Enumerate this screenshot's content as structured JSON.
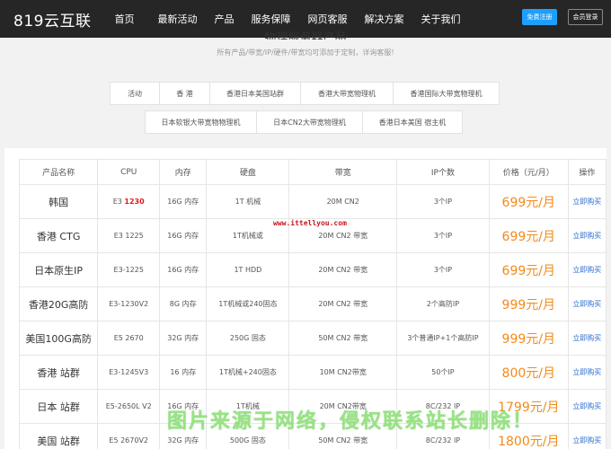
{
  "header": {
    "logo": "819云互联",
    "nav": [
      "首页",
      "最新活动",
      "产品",
      "服务保障",
      "网页客服",
      "解决方案",
      "关于我们"
    ],
    "register_label": "免费注册",
    "login_label": "会员登录"
  },
  "section": {
    "title": "物理服务器产品",
    "subtitle": "所有产品/带宽/IP/硬件/带宽均可添加于定制，详询客服!"
  },
  "filters": {
    "row1": [
      "活动",
      "香 港",
      "香港日本美国站群",
      "香港大带宽物理机",
      "香港国际大带宽物理机"
    ],
    "row2": [
      "日本软银大带宽物物理机",
      "日本CN2大带宽物理机",
      "香港日本美国 宿主机"
    ]
  },
  "table": {
    "headers": [
      "产品名称",
      "CPU",
      "内存",
      "硬盘",
      "带宽",
      "IP个数",
      "价格（元/月）",
      "操作"
    ],
    "rows": [
      {
        "name": "韩国",
        "cpu_prefix": "E3 ",
        "cpu_highlight": "1230",
        "mem": "16G 内存",
        "disk": "1T 机械",
        "bw": "20M CN2",
        "ip": "3个IP",
        "price": "699元/月",
        "action": "立即购买"
      },
      {
        "name": "香港 CTG",
        "cpu_prefix": "E3 1225",
        "cpu_highlight": "",
        "mem": "16G 内存",
        "disk": "1T机械或",
        "bw": "20M CN2 带宽",
        "ip": "3个IP",
        "price": "699元/月",
        "action": "立即购买"
      },
      {
        "name": "日本原生IP",
        "cpu_prefix": "E3-1225",
        "cpu_highlight": "",
        "mem": "16G 内存",
        "disk": "1T HDD",
        "bw": "20M CN2 带宽",
        "ip": "3个IP",
        "price": "699元/月",
        "action": "立即购买"
      },
      {
        "name": "香港20G高防",
        "cpu_prefix": "E3-1230V2",
        "cpu_highlight": "",
        "mem": "8G 内存",
        "disk": "1T机械或240固态",
        "bw": "20M CN2 带宽",
        "ip": "2个高防IP",
        "price": "999元/月",
        "action": "立即购买"
      },
      {
        "name": "美国100G高防",
        "cpu_prefix": "E5 2670",
        "cpu_highlight": "",
        "mem": "32G 内存",
        "disk": "250G 固态",
        "bw": "50M CN2 带宽",
        "ip": "3个普通IP+1个高防IP",
        "price": "999元/月",
        "action": "立即购买"
      },
      {
        "name": "香港 站群",
        "cpu_prefix": "E3-1245V3",
        "cpu_highlight": "",
        "mem": "16 内存",
        "disk": "1T机械+240固态",
        "bw": "10M CN2带宽",
        "ip": "50个IP",
        "price": "800元/月",
        "action": "立即购买"
      },
      {
        "name": "日本 站群",
        "cpu_prefix": "E5-2650L V2",
        "cpu_highlight": "",
        "mem": "16G 内存",
        "disk": "1T机械",
        "bw": "20M CN2带宽",
        "ip": "8C/232 IP",
        "price": "1799元/月",
        "action": "立即购买"
      },
      {
        "name": "美国 站群",
        "cpu_prefix": "E5 2670V2",
        "cpu_highlight": "",
        "mem": "32G 内存",
        "disk": "500G 固态",
        "bw": "50M CN2 带宽",
        "ip": "8C/232 IP",
        "price": "1800元/月",
        "action": "立即购买"
      }
    ]
  },
  "watermarks": {
    "site": "www.ittellyou.com",
    "notice": "图片来源于网络，侵权联系站长删除！"
  }
}
